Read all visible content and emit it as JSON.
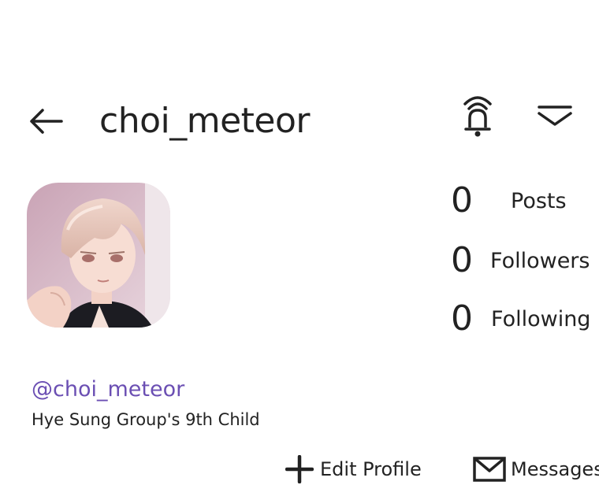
{
  "header": {
    "title": "choi_meteor",
    "back_icon": "arrow-left-icon",
    "bell_icon": "bell-ringing-icon",
    "menu_icon": "chevron-down-icon"
  },
  "profile": {
    "handle": "@choi_meteor",
    "bio": "Hye Sung Group's 9th Child",
    "avatar_icon": "avatar-illustration"
  },
  "stats": [
    {
      "value": "0",
      "label": "Posts"
    },
    {
      "value": "0",
      "label": "Followers"
    },
    {
      "value": "0",
      "label": "Following"
    }
  ],
  "actions": {
    "edit_label": "Edit  Profile",
    "messages_label": "Messages"
  },
  "colors": {
    "handle": "#6b4fb3",
    "text": "#222222",
    "background": "#ffffff"
  }
}
